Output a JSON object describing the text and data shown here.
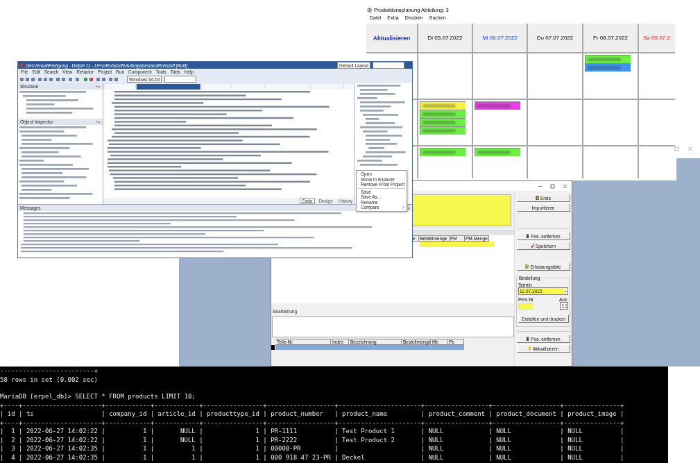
{
  "planner": {
    "title": "Produktionsplanung  Abteilung: 3",
    "menu": [
      "Datei",
      "Extra",
      "Drucken",
      "Suchen"
    ],
    "refresh_button": "Aktualisieren",
    "days": [
      {
        "label": "Di  05.07.2022",
        "kind": "workday"
      },
      {
        "label": "Mi  06.07.2022",
        "kind": "today"
      },
      {
        "label": "Do  07.07.2022",
        "kind": "workday"
      },
      {
        "label": "Fr  08.07.2022",
        "kind": "workday"
      },
      {
        "label": "Sa  09.07.2",
        "kind": "weekend"
      }
    ],
    "rows": [
      {
        "cells": [
          {
            "kind": "empty"
          },
          {
            "kind": "empty"
          },
          {
            "kind": "empty"
          },
          {
            "kind": "filled",
            "cards": [
              {
                "color": "#6cf043"
              },
              {
                "color": "#3d94ef"
              }
            ]
          },
          {
            "kind": "empty"
          }
        ]
      },
      {
        "cells": [
          {
            "kind": "filled",
            "cards": [
              {
                "color": "#f6f542"
              },
              {
                "color": "#6cf043"
              },
              {
                "color": "#6cf043"
              },
              {
                "color": "#6cf043"
              }
            ]
          },
          {
            "kind": "filled",
            "cards": [
              {
                "color": "#e83de8"
              }
            ]
          },
          {
            "kind": "empty"
          },
          {
            "kind": "empty"
          },
          {
            "kind": "empty"
          }
        ]
      },
      {
        "cells": [
          {
            "kind": "filled",
            "cards": [
              {
                "color": "#6cf043"
              }
            ]
          },
          {
            "kind": "filled",
            "cards": [
              {
                "color": "#6cf043"
              }
            ]
          },
          {
            "kind": "empty"
          },
          {
            "kind": "empty"
          },
          {
            "kind": "empty"
          }
        ]
      }
    ]
  },
  "order_form": {
    "upper_grid": {
      "columns": [
        "e",
        "Bestellmenge",
        "PM",
        "PM-Menge"
      ]
    },
    "edit_group": "Bearbeitung",
    "lower_grid": {
      "columns": [
        "Teile-Nr.",
        "Index",
        "Bezeichnung",
        "Bestellmenge",
        "Me",
        "Pe"
      ]
    },
    "button_groups": [
      [
        {
          "label": "Ende",
          "kind": "exit"
        },
        {
          "label": "Importieren",
          "kind": "import"
        }
      ],
      [
        {
          "label": "Pos. entfernen",
          "kind": "delete"
        },
        {
          "label": "Speichern",
          "kind": "save"
        },
        {
          "label": "Erfassungsliste",
          "kind": "report"
        }
      ]
    ],
    "order_group": {
      "title": "Bestellung",
      "date_label": "Termin",
      "date_value": "12.07.2022",
      "staff_label": "Pers.Nr",
      "count_label": "Anz.",
      "count_value": "1",
      "create_button": "Erstellen und drucken"
    },
    "bottom_buttons": [
      {
        "label": "Pos. entfernen",
        "kind": "delete"
      },
      {
        "label": "Aktualisieren",
        "kind": "refresh"
      }
    ]
  },
  "ide": {
    "title": "GesVerwaltFertigung - Delphi 11 - UFrmRohstoffeAuftragsbestandRohstoff [Built]",
    "layout": "Default Layout",
    "menu": [
      "File",
      "Edit",
      "Search",
      "View",
      "Refactor",
      "Project",
      "Run",
      "Component",
      "Tools",
      "Tabs",
      "Help"
    ],
    "platform": "Windows 64-bit",
    "structure_title": "Structure",
    "inspector_title": "Object Inspector",
    "view_tabs": [
      {
        "label": "Code",
        "selected": true
      },
      {
        "label": "Design",
        "selected": false
      },
      {
        "label": "History",
        "selected": false
      }
    ],
    "messages_title": "Messages",
    "context_menu": [
      {
        "kind": "item",
        "label": "Open"
      },
      {
        "kind": "item",
        "label": "Show in Explorer"
      },
      {
        "kind": "item",
        "label": "Remove From Project"
      },
      {
        "kind": "separator"
      },
      {
        "kind": "item",
        "label": "Save"
      },
      {
        "kind": "item",
        "label": "Save As..."
      },
      {
        "kind": "item",
        "label": "Rename"
      },
      {
        "kind": "item",
        "label": "Compare",
        "submenu": true
      }
    ]
  },
  "terminal": {
    "lines": [
      {
        "text": "-------------------------+"
      },
      {
        "text": "58 rows in set (0.002 sec)"
      },
      {
        "text": "MariaDB [erpel_db]> SELECT * FROM products LIMIT 10;"
      },
      {
        "text": "+----+---------------------+------------+------------+----------------+------------------+----------------------+-----------------+------------------+---------------+"
      },
      {
        "text": "| id | ts                  | company_id | article_id | producttype_id | product_number   | product_name         | product_comment | product_document | product_image |"
      },
      {
        "text": "+----+---------------------+------------+------------+----------------+------------------+----------------------+-----------------+------------------+---------------+"
      },
      {
        "text": "|  1 | 2022-06-27 14:02:22 |          1 |       NULL |              1 | PR-1111          | Test Product 1       | NULL            | NULL             | NULL          |"
      },
      {
        "text": "|  2 | 2022-06-27 14:02:22 |          1 |       NULL |              1 | PR-2222          | Test Product 2       | NULL            | NULL             | NULL          |"
      },
      {
        "text": "|  3 | 2022-06-27 14:02:35 |          1 |          1 |              1 | 00000-PR         |                      | NULL            | NULL             | NULL          |"
      },
      {
        "text": "|  4 | 2022-06-27 14:02:35 |          1 |          1 |              1 | 000 918 47 23-PR | Deckel               | NULL            | NULL             | NULL          |"
      }
    ]
  }
}
